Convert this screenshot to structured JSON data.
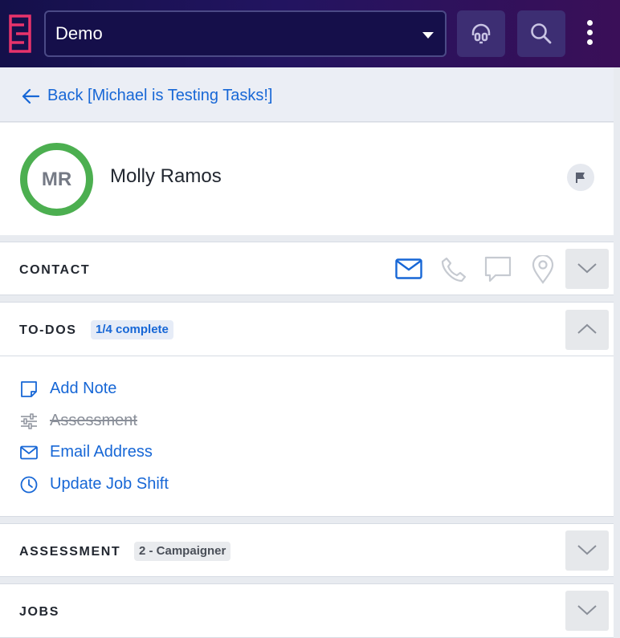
{
  "header": {
    "org_name": "Demo",
    "logo_icon": "stacked-bars-logo",
    "support_icon": "headset-icon",
    "search_icon": "search-icon",
    "more_icon": "kebab-menu-icon"
  },
  "back": {
    "label": "Back [Michael is Testing Tasks!]"
  },
  "profile": {
    "initials": "MR",
    "name": "Molly Ramos",
    "status_color": "#4caf50"
  },
  "contact": {
    "title": "CONTACT",
    "icons": [
      "email-icon",
      "phone-icon",
      "chat-icon",
      "location-pin-icon"
    ]
  },
  "todos": {
    "title": "TO-DOS",
    "badge": "1/4 complete",
    "items": [
      {
        "label": "Add Note",
        "icon": "note-icon",
        "done": false
      },
      {
        "label": "Assessment",
        "icon": "sliders-icon",
        "done": true
      },
      {
        "label": "Email Address",
        "icon": "email-icon",
        "done": false
      },
      {
        "label": "Update Job Shift",
        "icon": "clock-icon",
        "done": false
      }
    ]
  },
  "assessment": {
    "title": "ASSESSMENT",
    "badge": "2 - Campaigner"
  },
  "jobs": {
    "title": "JOBS"
  },
  "colors": {
    "accent": "#1767d6",
    "brand_logo": "#e8336b",
    "header_start": "#14104a",
    "header_end": "#3a0f58"
  }
}
